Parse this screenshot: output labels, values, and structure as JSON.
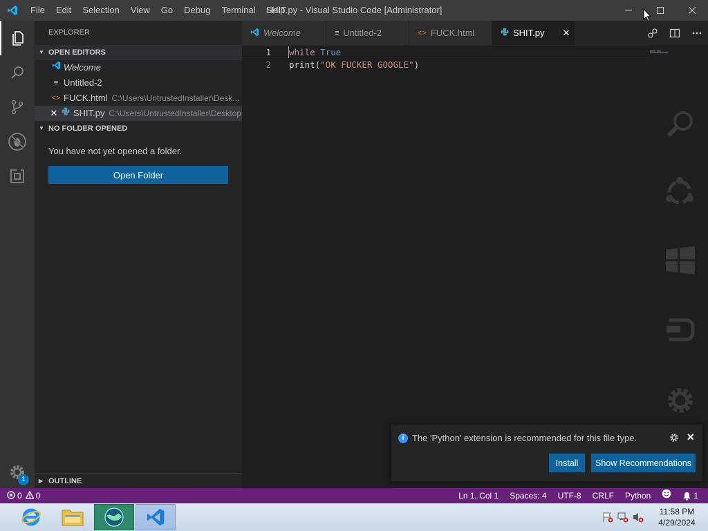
{
  "titlebar": {
    "title": "SHIT.py - Visual Studio Code [Administrator]",
    "menu": [
      "File",
      "Edit",
      "Selection",
      "View",
      "Go",
      "Debug",
      "Terminal",
      "Help"
    ]
  },
  "activitybar": {
    "icons": [
      "explorer-icon",
      "search-icon",
      "source-control-icon",
      "debug-icon",
      "extensions-icon"
    ],
    "manage_badge": "1"
  },
  "sidebar": {
    "title": "EXPLORER",
    "open_editors_header": "OPEN EDITORS",
    "open_editors": [
      {
        "name": "Welcome",
        "path": "",
        "icon": "vscode-icon",
        "italic": true
      },
      {
        "name": "Untitled-2",
        "path": "",
        "icon": "lines-icon",
        "italic": false
      },
      {
        "name": "FUCK.html",
        "path": "C:\\Users\\UntrustedInstaller\\Desk...",
        "icon": "html-icon",
        "italic": false
      },
      {
        "name": "SHIT.py",
        "path": "C:\\Users\\UntrustedInstaller\\Desktop",
        "icon": "python-icon",
        "italic": false
      }
    ],
    "no_folder_header": "NO FOLDER OPENED",
    "no_folder_message": "You have not yet opened a folder.",
    "open_folder_label": "Open Folder",
    "outline_header": "OUTLINE"
  },
  "tabs": [
    {
      "label": "Welcome",
      "icon": "vscode-icon"
    },
    {
      "label": "Untitled-2",
      "icon": "lines-icon"
    },
    {
      "label": "FUCK.html",
      "icon": "html-icon"
    },
    {
      "label": "SHIT.py",
      "icon": "python-icon",
      "close": "✕"
    }
  ],
  "editor": {
    "lines": [
      {
        "number": "1",
        "keyword": "while",
        "constant": "True"
      },
      {
        "number": "2",
        "func": "print(",
        "string": "\"OK FUCKER GOOGLE\"",
        "tail": ")"
      }
    ]
  },
  "notification": {
    "message": "The 'Python' extension is recommended for this file type.",
    "install_label": "Install",
    "show_label": "Show Recommendations"
  },
  "statusbar": {
    "errors": "0",
    "warnings": "0",
    "position": "Ln 1, Col 1",
    "spaces": "Spaces: 4",
    "encoding": "UTF-8",
    "eol": "CRLF",
    "language": "Python",
    "bell_count": "1"
  },
  "taskbar": {
    "time": "11:58 PM",
    "date": "4/29/2024"
  },
  "colors": {
    "statusbar": "#68217a",
    "accent": "#0e639c",
    "keyword": "#c586c0",
    "constant": "#569cd6",
    "string": "#ce9178"
  }
}
